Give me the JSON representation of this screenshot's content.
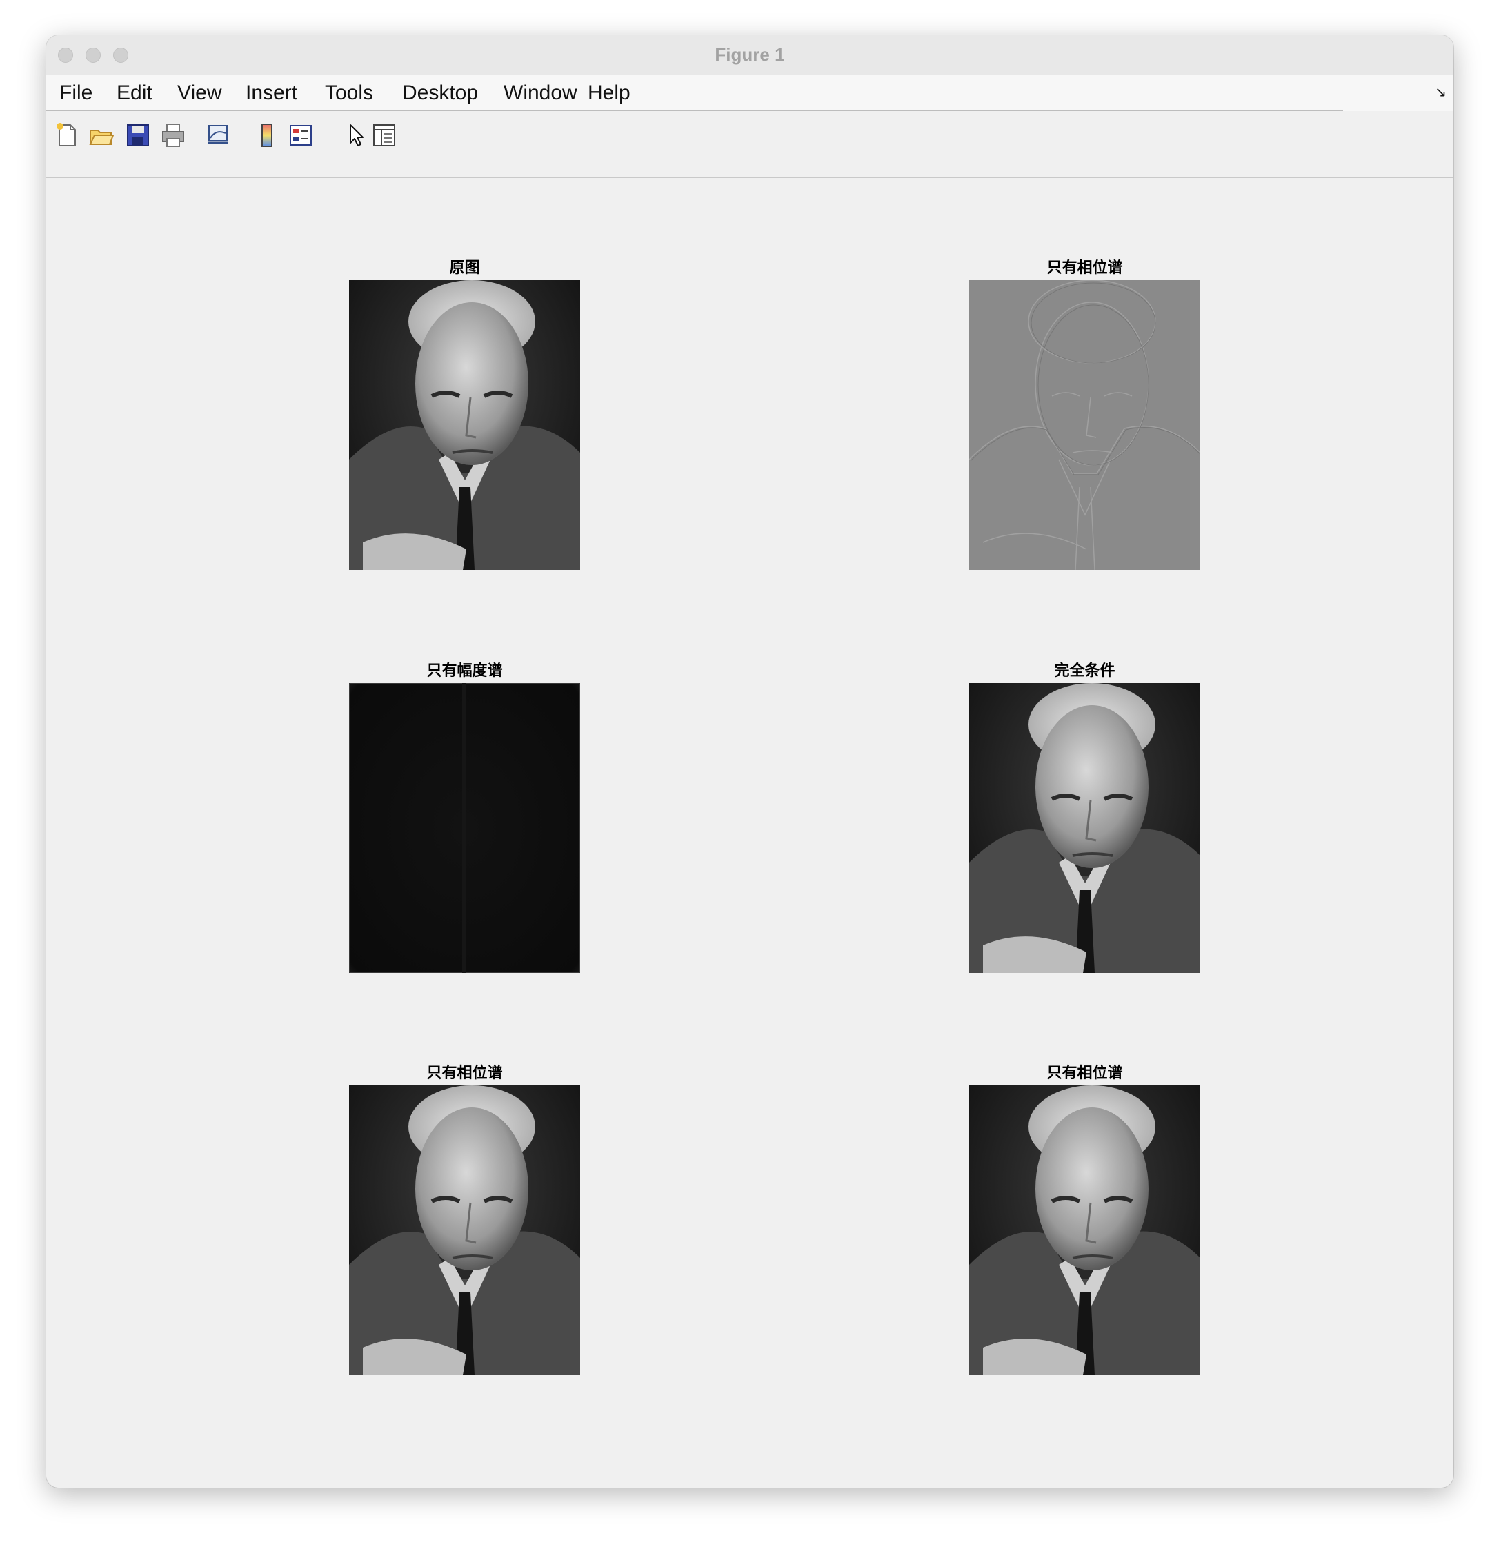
{
  "window": {
    "title": "Figure 1"
  },
  "menu": {
    "items": [
      "File",
      "Edit",
      "View",
      "Insert",
      "Tools",
      "Desktop",
      "Window",
      "Help"
    ]
  },
  "toolbar": {
    "icons": [
      "new-figure-icon",
      "open-file-icon",
      "save-icon",
      "print-icon",
      "link-icon",
      "colorbar-icon",
      "legend-icon",
      "pointer-icon",
      "property-editor-icon"
    ]
  },
  "subplots": [
    {
      "title": "原图",
      "image": "portrait-original"
    },
    {
      "title": "只有相位谱",
      "image": "phase-only-edge-map"
    },
    {
      "title": "只有幅度谱",
      "image": "amplitude-only-dark"
    },
    {
      "title": "完全条件",
      "image": "portrait-full-reconstruction"
    },
    {
      "title": "只有相位谱",
      "image": "portrait-phase-reconstruction"
    },
    {
      "title": "只有相位谱",
      "image": "portrait-phase-reconstruction"
    }
  ]
}
